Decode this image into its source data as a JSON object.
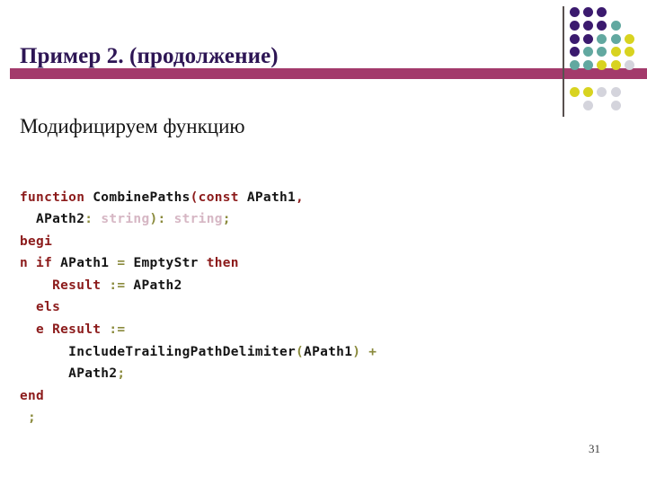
{
  "slide": {
    "title": "Пример 2. (продолжение)",
    "subtitle": "Модифицируем функцию",
    "page_number": "31"
  },
  "colors": {
    "title_text": "#2d1554",
    "title_bar": "#a33a6b",
    "divider": "#58504f",
    "subtitle_text": "#151515",
    "code_keyword": "#8c1b1b",
    "code_identifier": "#151515",
    "code_symbol": "#8a8a3c",
    "code_type": "#d6b7c4",
    "dot_purple": "#3b1a6e",
    "dot_teal": "#62a8a0",
    "dot_yellow": "#d8d320",
    "dot_grey": "#d4d4dc",
    "page_number_text": "#3a3a3a"
  },
  "dots": [
    {
      "col": 0,
      "row": 0,
      "color": "#3b1a6e"
    },
    {
      "col": 1,
      "row": 0,
      "color": "#3b1a6e"
    },
    {
      "col": 2,
      "row": 0,
      "color": "#3b1a6e"
    },
    {
      "col": 0,
      "row": 1,
      "color": "#3b1a6e"
    },
    {
      "col": 1,
      "row": 1,
      "color": "#3b1a6e"
    },
    {
      "col": 2,
      "row": 1,
      "color": "#3b1a6e"
    },
    {
      "col": 3,
      "row": 1,
      "color": "#62a8a0"
    },
    {
      "col": 0,
      "row": 2,
      "color": "#3b1a6e"
    },
    {
      "col": 1,
      "row": 2,
      "color": "#3b1a6e"
    },
    {
      "col": 2,
      "row": 2,
      "color": "#62a8a0"
    },
    {
      "col": 3,
      "row": 2,
      "color": "#62a8a0"
    },
    {
      "col": 4,
      "row": 2,
      "color": "#d8d320"
    },
    {
      "col": 0,
      "row": 3,
      "color": "#3b1a6e"
    },
    {
      "col": 1,
      "row": 3,
      "color": "#62a8a0"
    },
    {
      "col": 2,
      "row": 3,
      "color": "#62a8a0"
    },
    {
      "col": 3,
      "row": 3,
      "color": "#d8d320"
    },
    {
      "col": 4,
      "row": 3,
      "color": "#d8d320"
    },
    {
      "col": 0,
      "row": 4,
      "color": "#62a8a0"
    },
    {
      "col": 1,
      "row": 4,
      "color": "#62a8a0"
    },
    {
      "col": 2,
      "row": 4,
      "color": "#d8d320"
    },
    {
      "col": 3,
      "row": 4,
      "color": "#d8d320"
    },
    {
      "col": 4,
      "row": 4,
      "color": "#d4d4dc"
    },
    {
      "col": 0,
      "row": 6,
      "color": "#d8d320"
    },
    {
      "col": 1,
      "row": 6,
      "color": "#d8d320"
    },
    {
      "col": 2,
      "row": 6,
      "color": "#d4d4dc"
    },
    {
      "col": 3,
      "row": 6,
      "color": "#d4d4dc"
    },
    {
      "col": 1,
      "row": 7,
      "color": "#d4d4dc"
    },
    {
      "col": 3,
      "row": 7,
      "color": "#d4d4dc"
    }
  ],
  "code": {
    "language": "pascal",
    "lines": [
      [
        {
          "text": "function ",
          "color": "#8c1b1b"
        },
        {
          "text": "CombinePaths",
          "color": "#151515"
        },
        {
          "text": "(const ",
          "color": "#8c1b1b"
        },
        {
          "text": "APath1",
          "color": "#151515"
        },
        {
          "text": ",",
          "color": "#8c1b1b"
        }
      ],
      [
        {
          "text": "  APath2",
          "color": "#151515"
        },
        {
          "text": ": ",
          "color": "#8a8a3c"
        },
        {
          "text": "string",
          "color": "#d6b7c4"
        },
        {
          "text": ")",
          "color": "#8a8a3c"
        },
        {
          "text": ": ",
          "color": "#8a8a3c"
        },
        {
          "text": "string",
          "color": "#d6b7c4"
        },
        {
          "text": ";",
          "color": "#8a8a3c"
        }
      ],
      [
        {
          "text": "begi",
          "color": "#8c1b1b"
        }
      ],
      [
        {
          "text": "n if ",
          "color": "#8c1b1b"
        },
        {
          "text": "APath1 ",
          "color": "#151515"
        },
        {
          "text": "= ",
          "color": "#8a8a3c"
        },
        {
          "text": "EmptyStr ",
          "color": "#151515"
        },
        {
          "text": "then",
          "color": "#8c1b1b"
        }
      ],
      [
        {
          "text": "    Result ",
          "color": "#8c1b1b"
        },
        {
          "text": ":= ",
          "color": "#8a8a3c"
        },
        {
          "text": "APath2",
          "color": "#151515"
        }
      ],
      [
        {
          "text": "  els",
          "color": "#8c1b1b"
        }
      ],
      [
        {
          "text": "  e Result ",
          "color": "#8c1b1b"
        },
        {
          "text": ":=",
          "color": "#8a8a3c"
        }
      ],
      [
        {
          "text": "      IncludeTrailingPathDelimiter",
          "color": "#151515"
        },
        {
          "text": "(",
          "color": "#8a8a3c"
        },
        {
          "text": "APath1",
          "color": "#151515"
        },
        {
          "text": ") +",
          "color": "#8a8a3c"
        }
      ],
      [
        {
          "text": "      APath2",
          "color": "#151515"
        },
        {
          "text": ";",
          "color": "#8a8a3c"
        }
      ],
      [
        {
          "text": "end",
          "color": "#8c1b1b"
        }
      ],
      [
        {
          "text": " ;",
          "color": "#8a8a3c"
        }
      ]
    ]
  }
}
